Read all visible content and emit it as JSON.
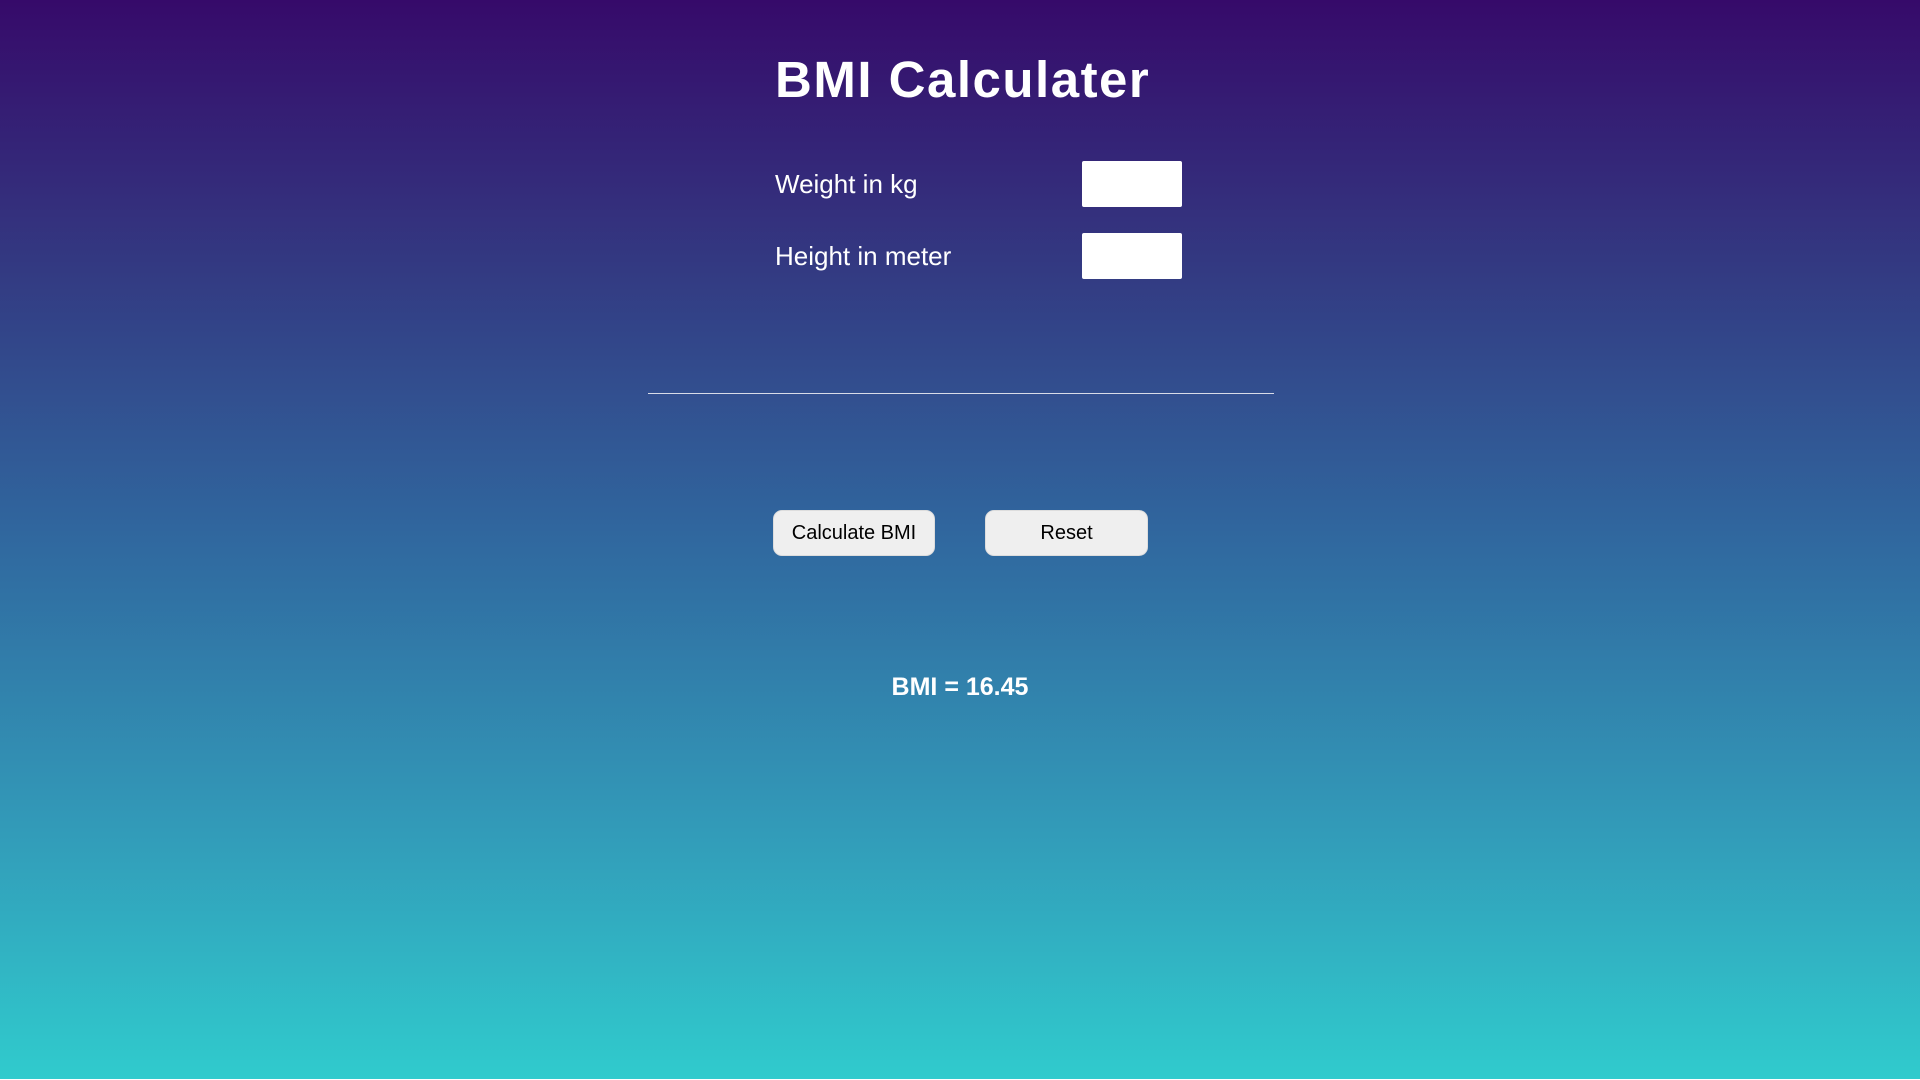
{
  "app": {
    "title": "BMI Calculater"
  },
  "form": {
    "weight_label": "Weight in kg",
    "weight_value": "",
    "height_label": "Height in meter",
    "height_value": ""
  },
  "actions": {
    "calculate_label": "Calculate BMI",
    "reset_label": "Reset"
  },
  "result": {
    "text": "BMI = 16.45"
  },
  "colors": {
    "gradient_top": "#360a6a",
    "gradient_bottom": "#30cbcd",
    "text": "#ffffff",
    "button_bg": "#efefef"
  }
}
